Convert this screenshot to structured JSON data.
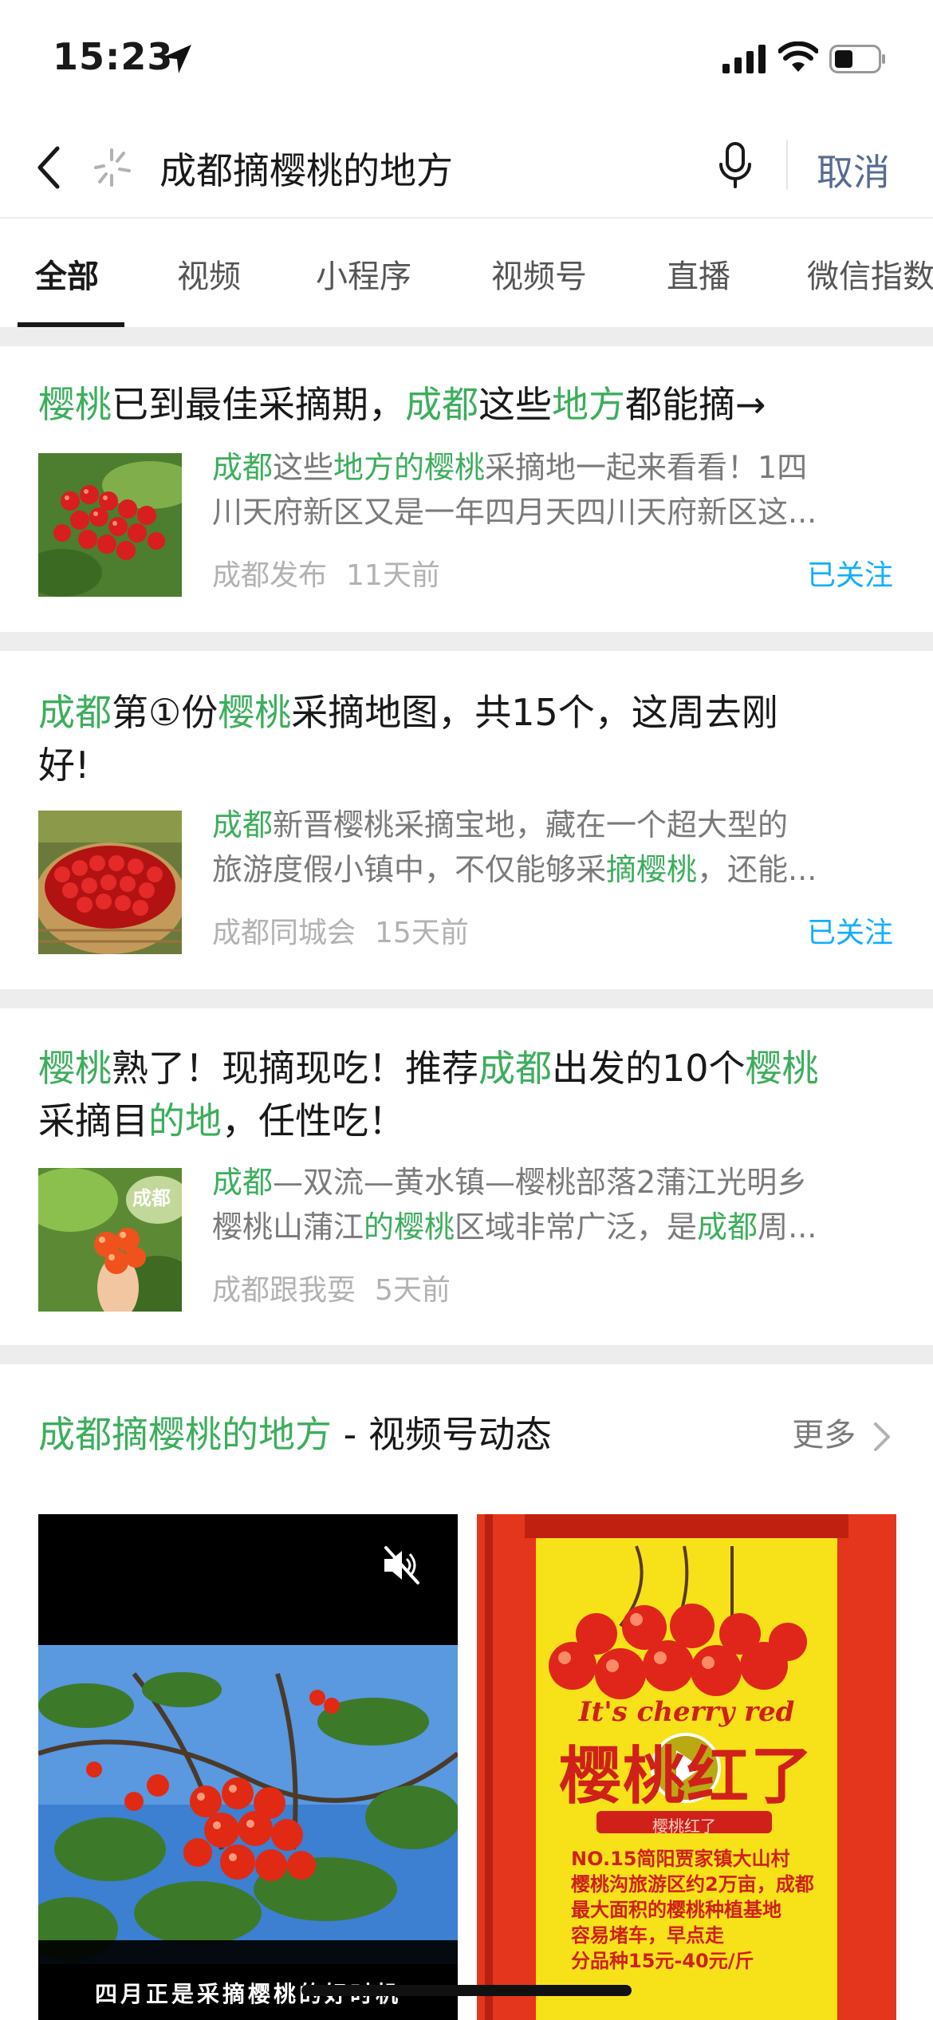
{
  "status": {
    "time": "15:23"
  },
  "search": {
    "query": "成都摘樱桃的地方",
    "cancel_label": "取消"
  },
  "tabs": [
    {
      "label": "全部"
    },
    {
      "label": "视频"
    },
    {
      "label": "小程序"
    },
    {
      "label": "视频号"
    },
    {
      "label": "直播"
    },
    {
      "label": "微信指数"
    }
  ],
  "results": [
    {
      "title_parts": [
        "樱桃",
        "已到最佳采摘期，",
        "成都",
        "这些",
        "地方",
        "都能摘→"
      ],
      "snippet_line1_parts": [
        "成都",
        "这些",
        "地方的樱桃",
        "采摘地一起来看看！1四"
      ],
      "snippet_line2": "川天府新区又是一年四月天四川天府新区这...",
      "source": "成都发布",
      "time": "11天前",
      "follow": "已关注"
    },
    {
      "title_parts": [
        "成都",
        "第①份",
        "樱桃",
        "采摘地图，共15个，这周去刚",
        "好!"
      ],
      "snippet_line1_parts": [
        "成都",
        "新晋樱桃采摘宝地，藏在一个超大型的"
      ],
      "snippet_line2_parts": [
        "旅游度假小镇中，不仅能够采",
        "摘樱桃",
        "，还能..."
      ],
      "source": "成都同城会",
      "time": "15天前",
      "follow": "已关注"
    },
    {
      "title_parts": [
        "樱桃",
        "熟了！现摘现吃！推荐",
        "成都",
        "出发的10个",
        "樱桃",
        "采摘目",
        "的地",
        "，任性吃！"
      ],
      "snippet_line1_parts": [
        "成都",
        "—双流—黄水镇—樱桃部落2蒲江光明乡"
      ],
      "snippet_line2_parts": [
        "樱桃山蒲江",
        "的樱桃",
        "区域非常广泛，是",
        "成都",
        "周..."
      ],
      "source": "成都跟我耍",
      "time": "5天前",
      "thumb_text": "成都"
    }
  ],
  "video_section": {
    "title_highlight": "成都摘樱桃的地方",
    "title_rest": " - 视频号动态",
    "more_label": "更多",
    "video1": {
      "caption": "四月正是采摘樱桃的好时机"
    },
    "video2": {
      "en_text": "It's cherry red",
      "big_text": "樱桃红了",
      "ribbon_text": "樱桃红了",
      "desc_lines": [
        "NO.15简阳贾家镇大山村",
        "樱桃沟旅游区约2万亩，成都",
        "最大面积的樱桃种植基地",
        "容易堵车，早点走",
        "分品种15元-40元/斤"
      ]
    }
  },
  "colors": {
    "highlight": "#3cae5c",
    "follow": "#10aeff",
    "cancel": "#576b95"
  }
}
